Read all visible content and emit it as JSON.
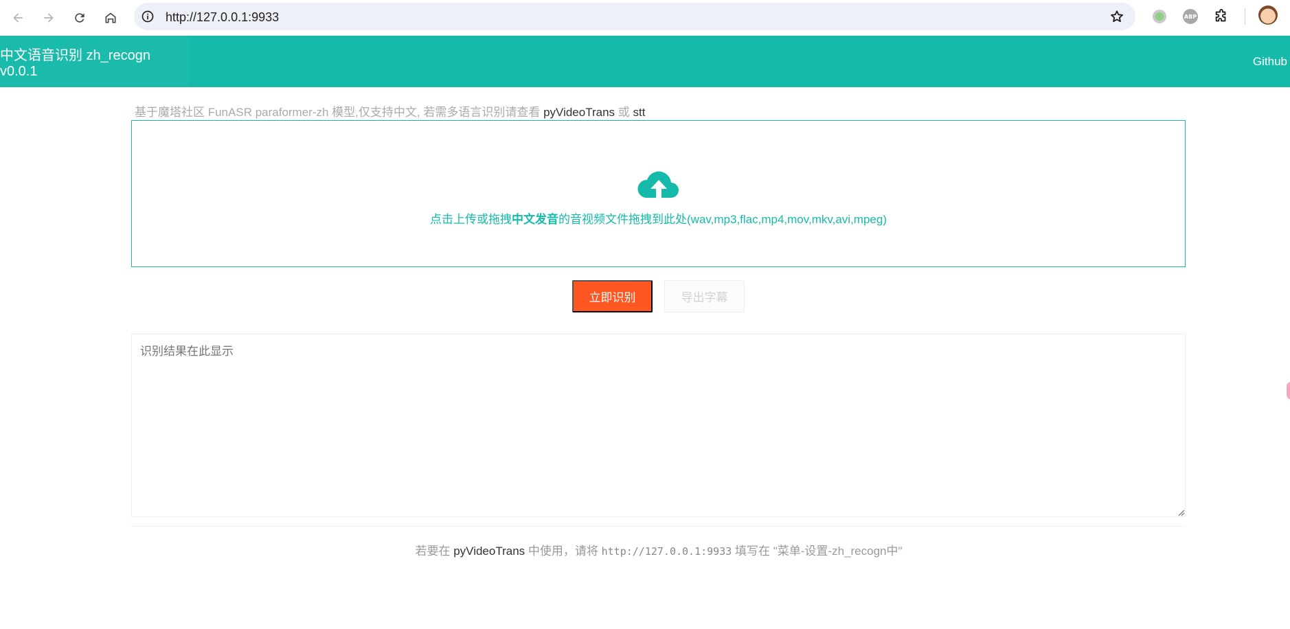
{
  "browser": {
    "url": "http://127.0.0.1:9933",
    "extensions": {
      "abp_label": "ABP"
    }
  },
  "header": {
    "title": "中文语音识别 zh_recogn v0.0.1",
    "github_label": "Github"
  },
  "intro": {
    "prefix": "基于魔塔社区 FunASR paraformer-zh 模型,仅支持中文, 若需多语言识别请查看 ",
    "link1": "pyVideoTrans",
    "middle": " 或 ",
    "link2": "stt"
  },
  "upload": {
    "text_before": "点击上传或拖拽",
    "text_bold": "中文发音",
    "text_after": "的音视频文件拖拽到此处(wav,mp3,flac,mp4,mov,mkv,avi,mpeg)",
    "color": "#16baaa"
  },
  "actions": {
    "recognize_label": "立即识别",
    "export_label": "导出字幕",
    "recognize_color": "#ff5722"
  },
  "result": {
    "placeholder": "识别结果在此显示",
    "value": ""
  },
  "footer": {
    "prefix": "若要在 ",
    "link": "pyVideoTrans",
    "middle": " 中使用，请将 ",
    "code": "http://127.0.0.1:9933",
    "suffix": " 填写在 \"菜单-设置-zh_recogn中\""
  },
  "theme": {
    "accent": "#16baaa"
  }
}
